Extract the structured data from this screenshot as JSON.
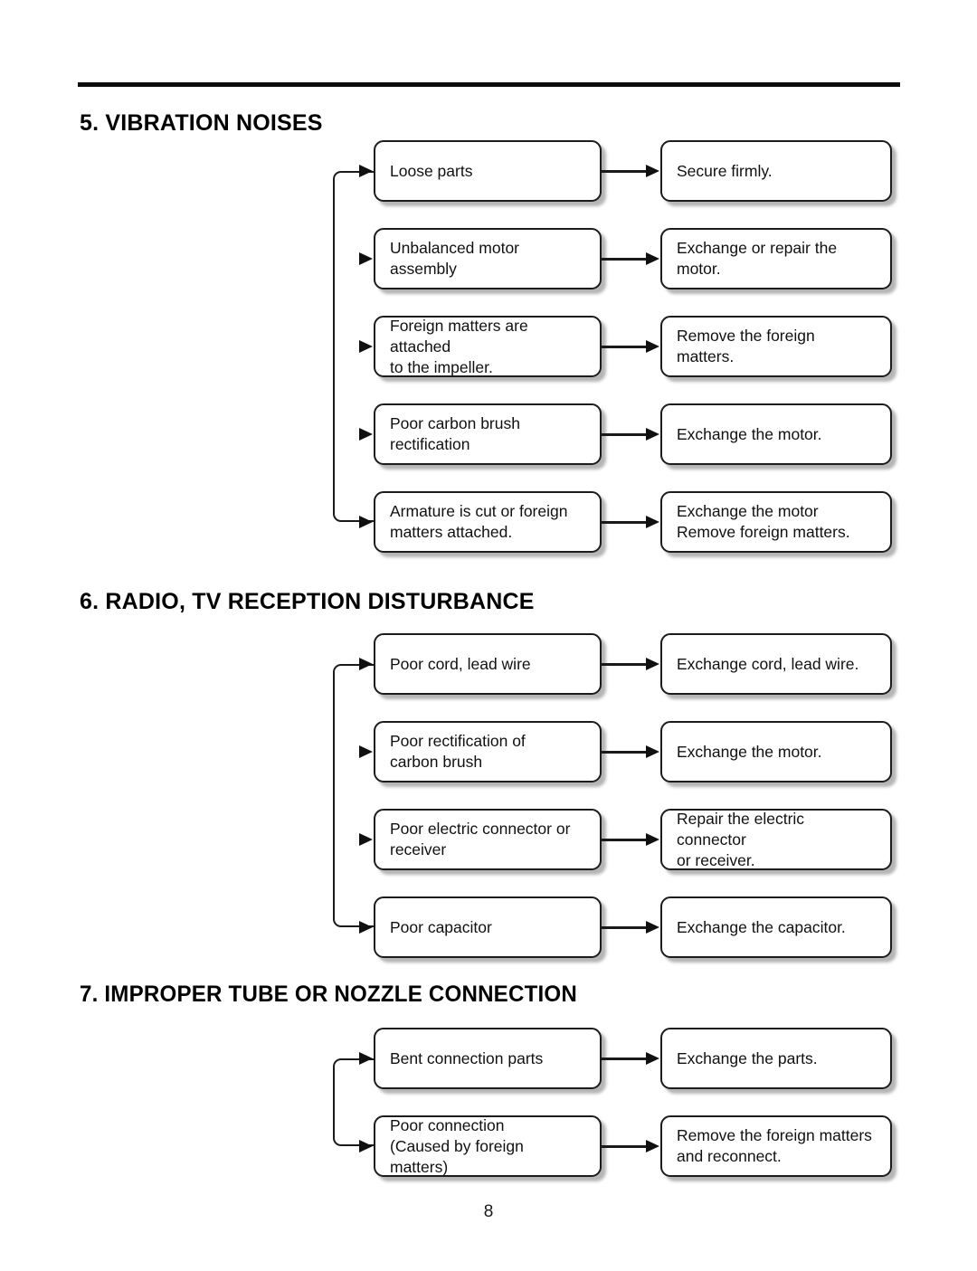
{
  "page": {
    "number": "8"
  },
  "sections": [
    {
      "heading": "5. VIBRATION NOISES",
      "rows": [
        {
          "cause": "Loose parts",
          "remedy": "Secure firmly."
        },
        {
          "cause": "Unbalanced motor assembly",
          "remedy": "Exchange or repair the motor."
        },
        {
          "cause": "Foreign matters are attached\nto the impeller.",
          "remedy": "Remove the foreign matters."
        },
        {
          "cause": "Poor carbon brush rectification",
          "remedy": "Exchange the motor."
        },
        {
          "cause": "Armature is cut or foreign\nmatters attached.",
          "remedy": "Exchange the motor\nRemove foreign matters."
        }
      ]
    },
    {
      "heading": "6. RADIO, TV RECEPTION DISTURBANCE",
      "rows": [
        {
          "cause": "Poor cord, lead wire",
          "remedy": "Exchange cord, lead wire."
        },
        {
          "cause": "Poor rectification of\ncarbon brush",
          "remedy": "Exchange the motor."
        },
        {
          "cause": "Poor electric connector or\nreceiver",
          "remedy": "Repair the electric connector\nor receiver."
        },
        {
          "cause": "Poor capacitor",
          "remedy": "Exchange the capacitor."
        }
      ]
    },
    {
      "heading": "7. IMPROPER TUBE OR NOZZLE CONNECTION",
      "rows": [
        {
          "cause": "Bent connection parts",
          "remedy": "Exchange the parts."
        },
        {
          "cause": "Poor connection\n(Caused by foreign matters)",
          "remedy": "Remove the foreign matters\nand reconnect."
        }
      ]
    }
  ],
  "colors": {
    "rule": "#0d0d0d",
    "box_border": "#1c1c1c",
    "text": "#111111",
    "shadow": "#787878"
  }
}
